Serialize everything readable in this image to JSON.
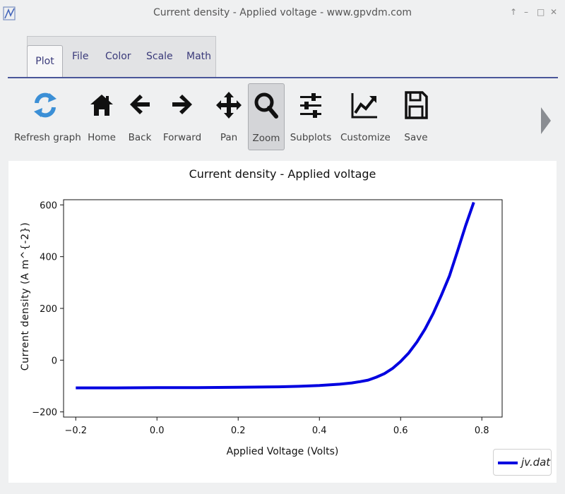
{
  "window": {
    "title": "Current density - Applied voltage - www.gpvdm.com",
    "controls": [
      "↑",
      "–",
      "□",
      "✕"
    ]
  },
  "tabs": [
    {
      "label": "Plot",
      "active": true
    },
    {
      "label": "File"
    },
    {
      "label": "Color"
    },
    {
      "label": "Scale"
    },
    {
      "label": "Math"
    }
  ],
  "toolbar": {
    "refresh": "Refresh graph",
    "home": "Home",
    "back": "Back",
    "forward": "Forward",
    "pan": "Pan",
    "zoom": "Zoom",
    "subplots": "Subplots",
    "customize": "Customize",
    "save": "Save",
    "active_tool": "Zoom"
  },
  "chart_data": {
    "type": "line",
    "title": "Current density - Applied voltage",
    "xlabel": "Applied Voltage (Volts)",
    "ylabel": "Current density (A m^{-2})",
    "xlim": [
      -0.23,
      0.85
    ],
    "ylim": [
      -220,
      620
    ],
    "xticks": [
      -0.2,
      0.0,
      0.2,
      0.4,
      0.6,
      0.8
    ],
    "xtick_labels": [
      "−0.2",
      "0.0",
      "0.2",
      "0.4",
      "0.6",
      "0.8"
    ],
    "yticks": [
      -200,
      0,
      200,
      400,
      600
    ],
    "ytick_labels": [
      "−200",
      "0",
      "200",
      "400",
      "600"
    ],
    "grid": false,
    "legend_position": "bottom-right, outside",
    "series": [
      {
        "name": "jv.dat",
        "color": "#0000e0",
        "x": [
          -0.2,
          -0.1,
          0.0,
          0.1,
          0.2,
          0.3,
          0.35,
          0.4,
          0.45,
          0.48,
          0.5,
          0.52,
          0.54,
          0.56,
          0.58,
          0.6,
          0.62,
          0.64,
          0.66,
          0.68,
          0.7,
          0.72,
          0.74,
          0.76,
          0.78
        ],
        "y": [
          -107,
          -107,
          -106,
          -106,
          -105,
          -103,
          -101,
          -98,
          -93,
          -88,
          -83,
          -77,
          -66,
          -52,
          -32,
          -5,
          28,
          70,
          120,
          180,
          250,
          325,
          420,
          520,
          610
        ]
      }
    ]
  }
}
